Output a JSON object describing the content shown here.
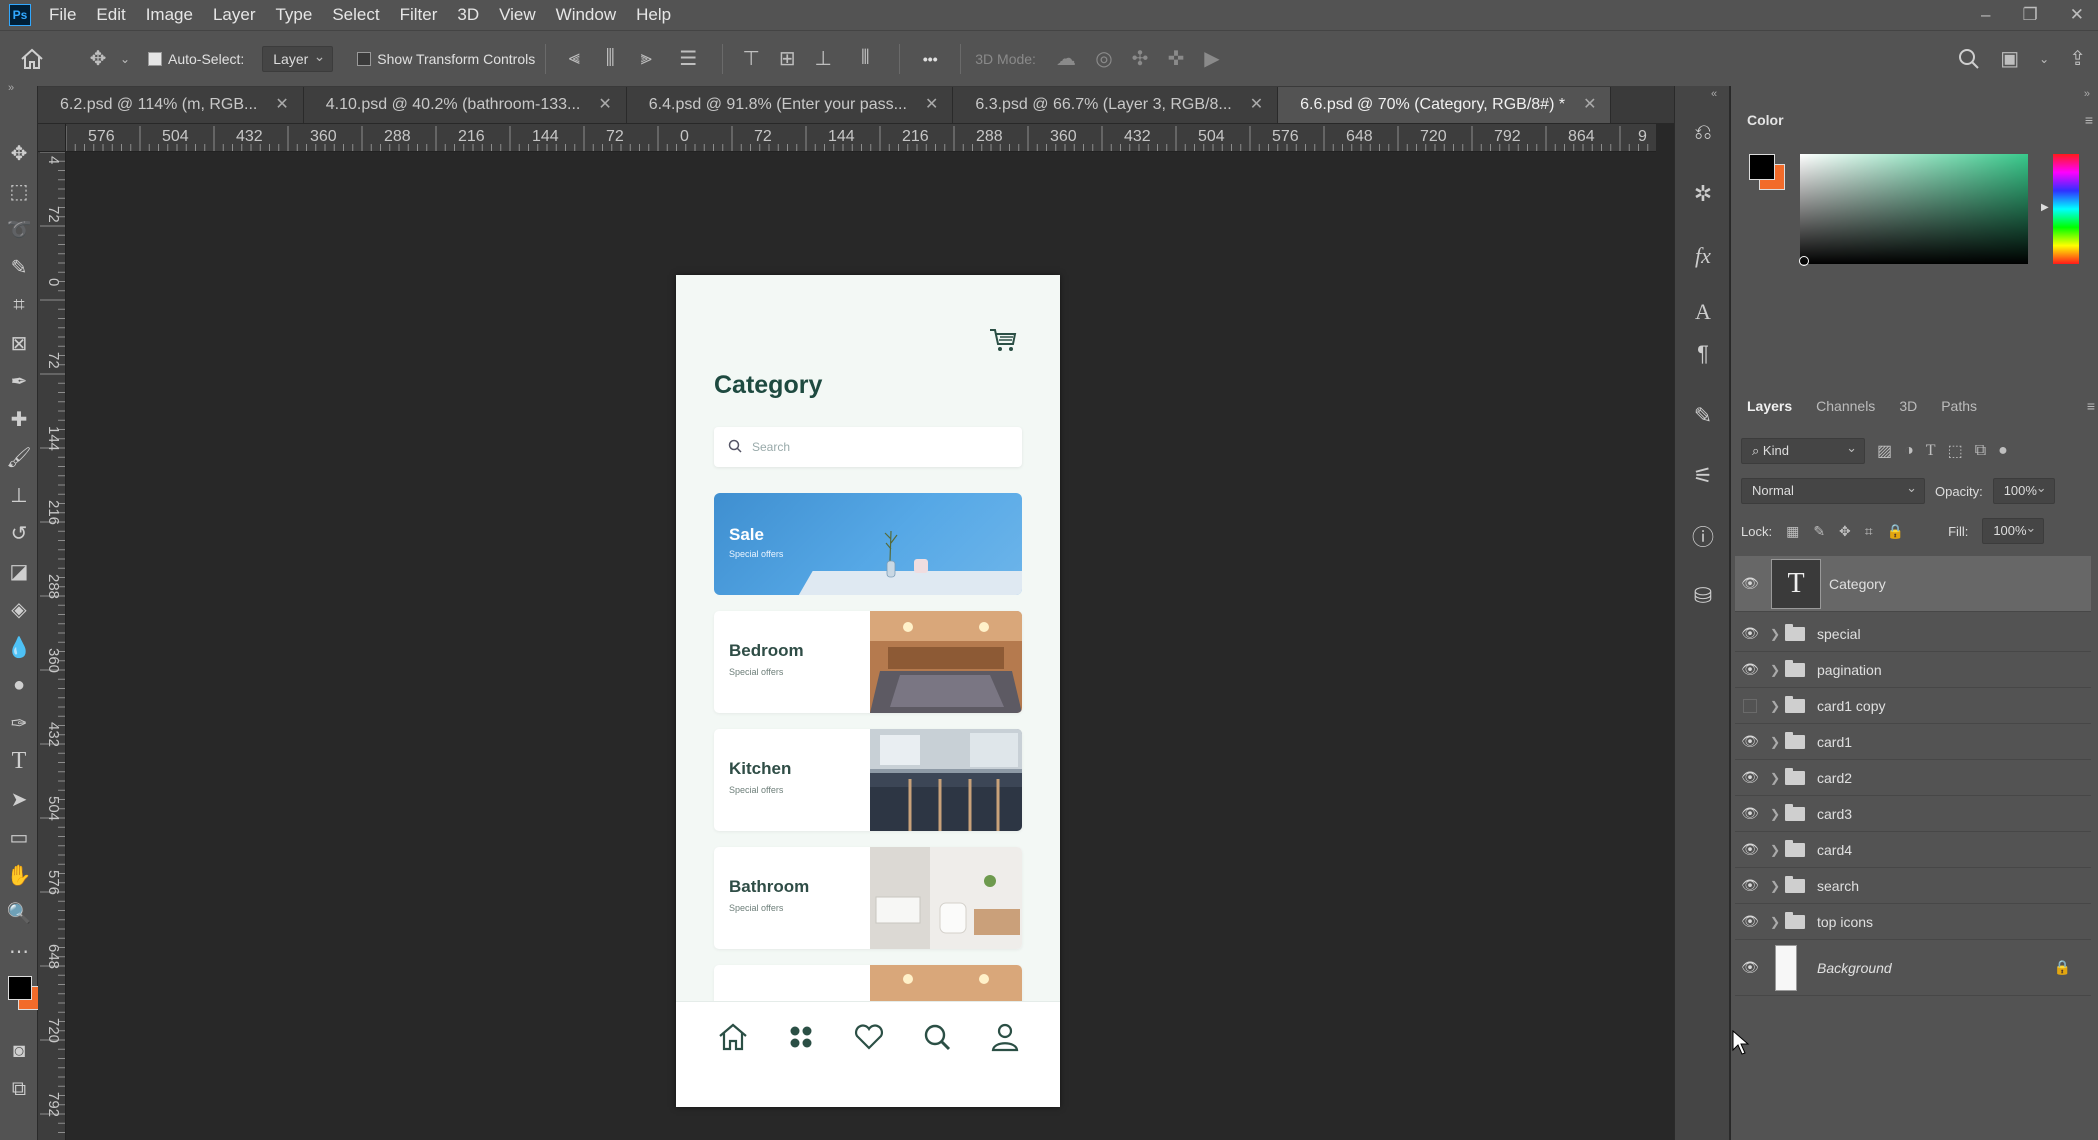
{
  "app": {
    "logo": "Ps"
  },
  "menu": [
    "File",
    "Edit",
    "Image",
    "Layer",
    "Type",
    "Select",
    "Filter",
    "3D",
    "View",
    "Window",
    "Help"
  ],
  "window_controls": [
    "–",
    "❐",
    "✕"
  ],
  "options": {
    "auto_select_label": "Auto-Select:",
    "auto_select_value": "Layer",
    "show_transform_label": "Show Transform Controls",
    "mode_3d_label": "3D Mode:",
    "more_label": "•••"
  },
  "tabs": [
    {
      "label": "6.2.psd @ 114% (m, RGB...",
      "active": false
    },
    {
      "label": "4.10.psd @ 40.2% (bathroom-133...",
      "active": false
    },
    {
      "label": "6.4.psd @ 91.8% (Enter your pass...",
      "active": false
    },
    {
      "label": "6.3.psd @ 66.7% (Layer 3, RGB/8...",
      "active": false
    },
    {
      "label": "6.6.psd @ 70% (Category, RGB/8#) *",
      "active": true
    }
  ],
  "ruler_h": [
    "576",
    "504",
    "432",
    "360",
    "288",
    "216",
    "144",
    "72",
    "0",
    "72",
    "144",
    "216",
    "288",
    "360",
    "432",
    "504",
    "576",
    "648",
    "720",
    "792",
    "864",
    "9"
  ],
  "ruler_v": [
    "4",
    "72",
    "0",
    "72",
    "144",
    "216",
    "288",
    "360",
    "432",
    "504",
    "576",
    "648",
    "720",
    "792"
  ],
  "document": {
    "title": "Category",
    "search_placeholder": "Search",
    "sale": {
      "title": "Sale",
      "subtitle": "Special offers"
    },
    "cards": [
      {
        "title": "Bedroom",
        "subtitle": "Special offers"
      },
      {
        "title": "Kitchen",
        "subtitle": "Special offers"
      },
      {
        "title": "Bathroom",
        "subtitle": "Special offers"
      }
    ]
  },
  "color_panel": {
    "title": "Color",
    "fg_color": "#000000",
    "bg_color": "#f26b2a"
  },
  "layers_panel": {
    "tabs": [
      "Layers",
      "Channels",
      "3D",
      "Paths"
    ],
    "kind_label": "Kind",
    "blend_mode": "Normal",
    "opacity_label": "Opacity:",
    "opacity_value": "100%",
    "lock_label": "Lock:",
    "fill_label": "Fill:",
    "fill_value": "100%",
    "layers": [
      {
        "name": "Category",
        "type": "text",
        "visible": true,
        "selected": true
      },
      {
        "name": "special",
        "type": "group",
        "visible": true
      },
      {
        "name": "pagination",
        "type": "group",
        "visible": true
      },
      {
        "name": "card1 copy",
        "type": "group",
        "visible": false
      },
      {
        "name": "card1",
        "type": "group",
        "visible": true
      },
      {
        "name": "card2",
        "type": "group",
        "visible": true
      },
      {
        "name": "card3",
        "type": "group",
        "visible": true
      },
      {
        "name": "card4",
        "type": "group",
        "visible": true
      },
      {
        "name": "search",
        "type": "group",
        "visible": true
      },
      {
        "name": "top icons",
        "type": "group",
        "visible": true
      },
      {
        "name": "Background",
        "type": "background",
        "visible": true,
        "locked": true
      }
    ]
  }
}
